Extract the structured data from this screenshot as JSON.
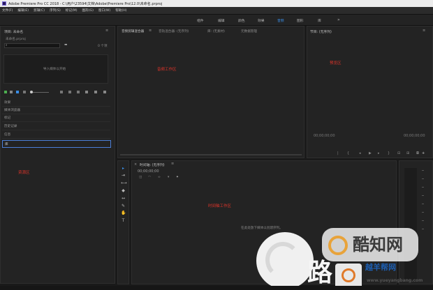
{
  "window": {
    "title": "Adobe Premiere Pro CC 2018 - C:\\用户\\23594\\文档\\Adobe\\Premiere Pro\\12.0\\未命名.prproj"
  },
  "menu": [
    "文件(F)",
    "编辑(E)",
    "剪辑(C)",
    "序列(S)",
    "标记(M)",
    "图形(G)",
    "窗口(W)",
    "帮助(H)"
  ],
  "workspaces": {
    "tabs": [
      "组件",
      "编辑",
      "颜色",
      "效果",
      "音频",
      "图形",
      "库"
    ],
    "active": "音频",
    "more": "»"
  },
  "project": {
    "title": "项目: 未命名",
    "file": "未命名.prproj",
    "item_count": "0 个项",
    "drop_hint": "导入媒体以开始",
    "list": [
      "效果",
      "媒体浏览器",
      "标记",
      "历史记录",
      "信息",
      "库"
    ]
  },
  "audio_mixer": {
    "tabs": [
      "音频剪辑混合器",
      "音轨混合器: (无序列)",
      "库: (无素材)",
      "元数据管理"
    ],
    "label": "音频工作区"
  },
  "program": {
    "title": "节目: (无序列)",
    "label": "预览区",
    "tc_left": "00;00;00;00",
    "tc_right": "00;00;00;00"
  },
  "timeline": {
    "title": "时间轴: (无序列)",
    "tc": "00;00;00;00",
    "label": "时间轴工作区",
    "hint": "在此处放下媒体以创建序列。"
  },
  "tools_label": "资源区",
  "watermark": {
    "text_big": "酷知网",
    "text_side": "路",
    "site": "越羊帮网",
    "url": "www.yueyangbang.com"
  },
  "colors": {
    "accent": "#3a8ee6",
    "label_red": "#e0342a",
    "panel": "#232323",
    "background": "#1a1a1a"
  }
}
